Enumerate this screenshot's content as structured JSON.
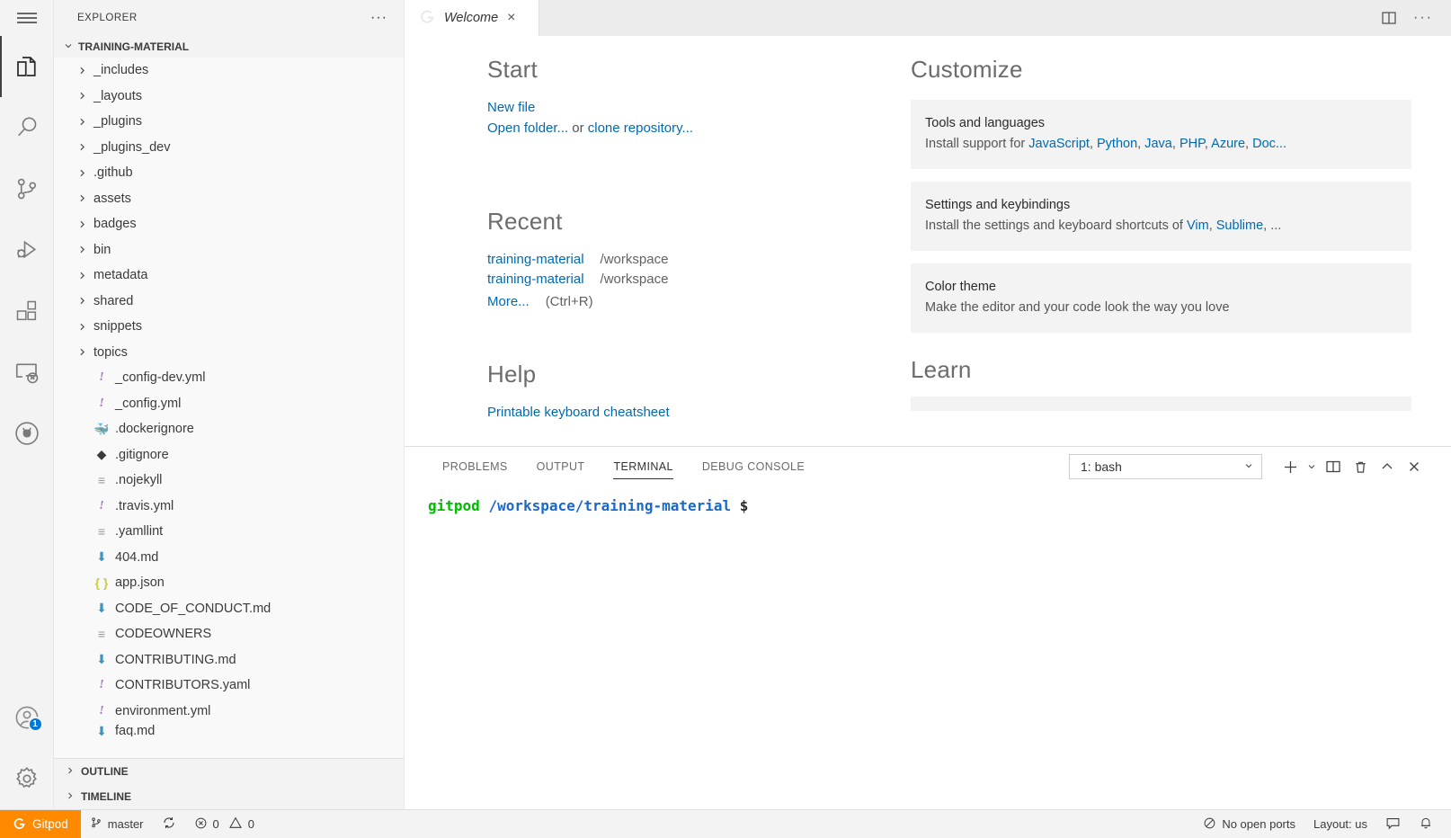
{
  "activitybar": {
    "menu_label": "menu-hamburger",
    "items": [
      {
        "name": "explorer",
        "label": "Explorer",
        "active": true
      },
      {
        "name": "search",
        "label": "Search",
        "active": false
      },
      {
        "name": "source-control",
        "label": "Source Control",
        "active": false
      },
      {
        "name": "run-debug",
        "label": "Run and Debug",
        "active": false
      },
      {
        "name": "extensions",
        "label": "Extensions",
        "active": false
      },
      {
        "name": "remote-explorer",
        "label": "Remote Explorer",
        "active": false
      },
      {
        "name": "github",
        "label": "GitHub",
        "active": false
      }
    ],
    "account_badge": "1",
    "settings_label": "Manage"
  },
  "sidebar": {
    "title": "EXPLORER",
    "more_actions": "···",
    "root_folder": "TRAINING-MATERIAL",
    "tree": [
      {
        "label": "_includes",
        "type": "folder",
        "icon": "chevron-right-icon"
      },
      {
        "label": "_layouts",
        "type": "folder",
        "icon": "chevron-right-icon"
      },
      {
        "label": "_plugins",
        "type": "folder",
        "icon": "chevron-right-icon"
      },
      {
        "label": "_plugins_dev",
        "type": "folder",
        "icon": "chevron-right-icon"
      },
      {
        "label": ".github",
        "type": "folder",
        "icon": "chevron-right-icon"
      },
      {
        "label": "assets",
        "type": "folder",
        "icon": "chevron-right-icon"
      },
      {
        "label": "badges",
        "type": "folder",
        "icon": "chevron-right-icon"
      },
      {
        "label": "bin",
        "type": "folder",
        "icon": "chevron-right-icon"
      },
      {
        "label": "metadata",
        "type": "folder",
        "icon": "chevron-right-icon"
      },
      {
        "label": "shared",
        "type": "folder",
        "icon": "chevron-right-icon"
      },
      {
        "label": "snippets",
        "type": "folder",
        "icon": "chevron-right-icon"
      },
      {
        "label": "topics",
        "type": "folder",
        "icon": "chevron-right-icon"
      },
      {
        "label": "_config-dev.yml",
        "type": "file",
        "icon": "yaml-file-icon",
        "glyph": "!"
      },
      {
        "label": "_config.yml",
        "type": "file",
        "icon": "yaml-file-icon",
        "glyph": "!"
      },
      {
        "label": ".dockerignore",
        "type": "file",
        "icon": "docker-file-icon",
        "glyph": "ὃ3"
      },
      {
        "label": ".gitignore",
        "type": "file",
        "icon": "git-file-icon",
        "glyph": "◆"
      },
      {
        "label": ".nojekyll",
        "type": "file",
        "icon": "text-file-icon",
        "glyph": "≡"
      },
      {
        "label": ".travis.yml",
        "type": "file",
        "icon": "yaml-file-icon",
        "glyph": "!"
      },
      {
        "label": ".yamllint",
        "type": "file",
        "icon": "text-file-icon",
        "glyph": "≡"
      },
      {
        "label": "404.md",
        "type": "file",
        "icon": "markdown-file-icon",
        "glyph": "⬇"
      },
      {
        "label": "app.json",
        "type": "file",
        "icon": "json-file-icon",
        "glyph": "{ }"
      },
      {
        "label": "CODE_OF_CONDUCT.md",
        "type": "file",
        "icon": "markdown-file-icon",
        "glyph": "⬇"
      },
      {
        "label": "CODEOWNERS",
        "type": "file",
        "icon": "text-file-icon",
        "glyph": "≡"
      },
      {
        "label": "CONTRIBUTING.md",
        "type": "file",
        "icon": "markdown-file-icon",
        "glyph": "⬇"
      },
      {
        "label": "CONTRIBUTORS.yaml",
        "type": "file",
        "icon": "yaml-file-icon",
        "glyph": "!"
      },
      {
        "label": "environment.yml",
        "type": "file",
        "icon": "yaml-file-icon",
        "glyph": "!"
      },
      {
        "label": "faq.md",
        "type": "file",
        "icon": "markdown-file-icon",
        "glyph": "⬇",
        "clipped": true
      }
    ],
    "panels": [
      {
        "label": "OUTLINE",
        "icon": "chevron-right-icon"
      },
      {
        "label": "TIMELINE",
        "icon": "chevron-right-icon"
      }
    ]
  },
  "editor": {
    "tab": {
      "title": "Welcome",
      "icon": "gitpod-logo-icon",
      "close": "×"
    },
    "actions": [
      {
        "name": "split-editor-icon"
      },
      {
        "name": "more-actions-icon",
        "glyph": "···"
      }
    ]
  },
  "welcome": {
    "start": {
      "heading": "Start",
      "new_file": "New file",
      "open_folder": "Open folder...",
      "or": "or",
      "clone_repository": "clone repository..."
    },
    "recent": {
      "heading": "Recent",
      "items": [
        {
          "name": "training-material",
          "path": "/workspace"
        },
        {
          "name": "training-material",
          "path": "/workspace"
        }
      ],
      "more": "More...",
      "more_shortcut": "(Ctrl+R)"
    },
    "help": {
      "heading": "Help",
      "first_link": "Printable keyboard cheatsheet"
    },
    "customize": {
      "heading": "Customize",
      "cards": [
        {
          "title": "Tools and languages",
          "desc_prefix": "Install support for ",
          "links": [
            "JavaScript",
            "Python",
            "Java",
            "PHP",
            "Azure",
            "Doc..."
          ]
        },
        {
          "title": "Settings and keybindings",
          "desc_prefix": "Install the settings and keyboard shortcuts of ",
          "links": [
            "Vim",
            "Sublime"
          ],
          "desc_suffix": ", ..."
        },
        {
          "title": "Color theme",
          "desc_plain": "Make the editor and your code look the way you love"
        }
      ]
    },
    "learn": {
      "heading": "Learn"
    }
  },
  "panel": {
    "tabs": [
      {
        "label": "PROBLEMS",
        "active": false
      },
      {
        "label": "OUTPUT",
        "active": false
      },
      {
        "label": "TERMINAL",
        "active": true
      },
      {
        "label": "DEBUG CONSOLE",
        "active": false
      }
    ],
    "terminal_select": {
      "value": "1: bash",
      "chevron": "⌄"
    },
    "actions": [
      {
        "name": "new-terminal-icon",
        "glyph": "+"
      },
      {
        "name": "new-terminal-dropdown-icon",
        "glyph": "⌄"
      },
      {
        "name": "split-terminal-icon"
      },
      {
        "name": "kill-terminal-icon"
      },
      {
        "name": "maximize-panel-icon",
        "glyph": "⌃"
      },
      {
        "name": "close-panel-icon",
        "glyph": "×"
      }
    ],
    "prompt": {
      "user": "gitpod",
      "path": "/workspace/training-material",
      "symbol": "$"
    }
  },
  "statusbar": {
    "gitpod_label": "Gitpod",
    "branch": "master",
    "sync_icon": "sync-icon",
    "errors": "0",
    "warnings": "0",
    "ports": "No open ports",
    "layout": "Layout: us",
    "feedback_icon": "feedback-icon",
    "bell_icon": "bell-icon"
  },
  "colors": {
    "accent_link": "#006ab1",
    "gitpod_orange": "#ff8a00",
    "badge_blue": "#0078d4",
    "terminal_green": "#00bb00",
    "terminal_blue": "#1a69c9"
  }
}
